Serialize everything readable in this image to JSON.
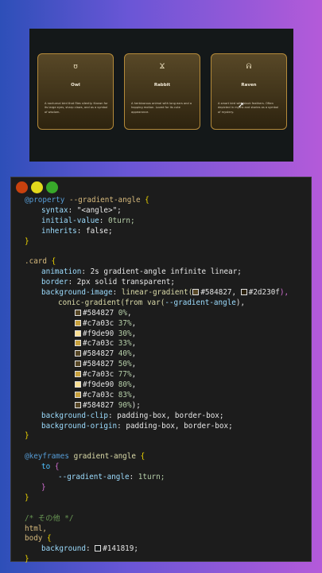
{
  "preview": {
    "cards": [
      {
        "icon": "owl-icon",
        "glyph": "ʊ",
        "title": "Owl",
        "text": "A nocturnal bird that flies silently. Known for its large eyes, sharp claws, and as a symbol of wisdom."
      },
      {
        "icon": "rabbit-icon",
        "glyph": "Ϫ",
        "title": "Rabbit",
        "text": "A herbivorous animal with long ears and a hopping motion. Loved for its cute appearance."
      },
      {
        "icon": "raven-icon",
        "glyph": "ᕱ",
        "title": "Raven",
        "text": "A smart bird with black feathers. Often depicted in myths and stories as a symbol of mystery."
      }
    ],
    "cursor": "➚"
  },
  "editor": {
    "window_controls": [
      "close",
      "minimize",
      "maximize"
    ],
    "code": {
      "at_property": "@property",
      "prop_name": "--gradient-angle",
      "open_brace": "{",
      "close_brace": "}",
      "syntax_prop": "syntax",
      "syntax_val": "\"<angle>\";",
      "initial_prop": "initial-value",
      "initial_val": "0turn;",
      "inherits_prop": "inherits",
      "inherits_val": "false;",
      "card_selector": ".card",
      "animation_prop": "animation",
      "animation_val": "2s gradient-angle infinite linear;",
      "border_prop": "border",
      "border_val": "2px solid transparent;",
      "bgimage_prop": "background-image",
      "bgimage_fn": "linear-gradient(",
      "color_a": "#584827",
      "color_b": "#2d230f",
      "conic_fn": "conic-gradient(from var(",
      "conic_var": "--gradient-angle",
      "stops": [
        {
          "color": "#584827",
          "pos": "0%",
          "sep": ","
        },
        {
          "color": "#c7a03c",
          "pos": "37%",
          "sep": ","
        },
        {
          "color": "#f9de90",
          "pos": "30%",
          "sep": ","
        },
        {
          "color": "#c7a03c",
          "pos": "33%",
          "sep": ","
        },
        {
          "color": "#584827",
          "pos": "40%",
          "sep": ","
        },
        {
          "color": "#584827",
          "pos": "50%",
          "sep": ","
        },
        {
          "color": "#c7a03c",
          "pos": "77%",
          "sep": ","
        },
        {
          "color": "#f9de90",
          "pos": "80%",
          "sep": ","
        },
        {
          "color": "#c7a03c",
          "pos": "83%",
          "sep": ","
        },
        {
          "color": "#584827",
          "pos": "90%",
          "sep": ");"
        }
      ],
      "clip_prop": "background-clip",
      "clip_val": "padding-box, border-box;",
      "origin_prop": "background-origin",
      "origin_val": "padding-box, border-box;",
      "keyframes_at": "@keyframes",
      "keyframes_name": "gradient-angle",
      "to_kw": "to",
      "kf_prop": "--gradient-angle",
      "kf_val": "1turn;",
      "comment": "/* その他 */",
      "html_sel": "html,",
      "body_sel": "body",
      "bg_prop": "background",
      "bg_color": "#141819",
      "bg_val": "#141819;"
    }
  }
}
